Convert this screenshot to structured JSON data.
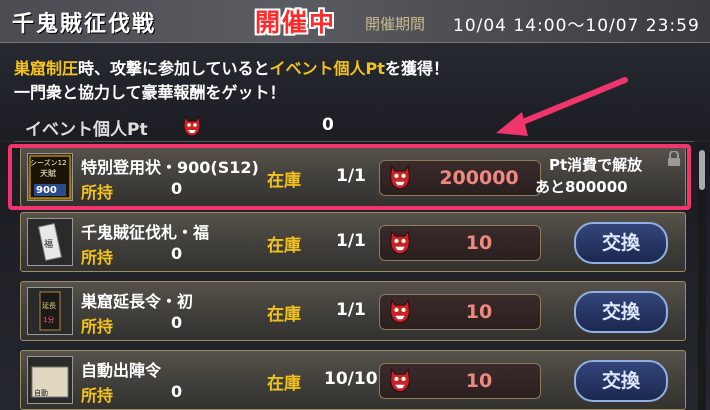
{
  "header": {
    "title": "千鬼賊征伐戦",
    "status_badge": "開催中",
    "period_label": "開催期間",
    "period_value": "10/04 14:00〜10/07 23:59"
  },
  "description": {
    "line1_hl1": "巣窟制圧",
    "line1_mid": "時、攻撃に参加していると",
    "line1_hl2": "イベント個人Pt",
    "line1_end": "を獲得！",
    "line2": "一門衆と協力して豪華報酬をゲット！"
  },
  "points": {
    "label": "イベント個人Pt",
    "value": "0"
  },
  "items": [
    {
      "name": "特別登用状・900(S12)",
      "owned_label": "所持",
      "owned": "0",
      "stock_label": "在庫",
      "stock": "1/1",
      "cost": "200000",
      "locked": true,
      "unlock_line1": "Pt消費で解放",
      "unlock_line2": "あと800000",
      "thumb_text_top": "シーズン12",
      "thumb_text_mid": "天賦",
      "thumb_text_bot": "900"
    },
    {
      "name": "千鬼賊征伐札・福",
      "owned_label": "所持",
      "owned": "0",
      "stock_label": "在庫",
      "stock": "1/1",
      "cost": "10",
      "button": "交換",
      "thumb_text": "福"
    },
    {
      "name": "巣窟延長令・初",
      "owned_label": "所持",
      "owned": "0",
      "stock_label": "在庫",
      "stock": "1/1",
      "cost": "10",
      "button": "交換",
      "thumb_text": "延長",
      "thumb_text2": "1分"
    },
    {
      "name": "自動出陣令",
      "owned_label": "所持",
      "owned": "0",
      "stock_label": "在庫",
      "stock": "10/10",
      "cost": "10",
      "button": "交換",
      "thumb_text": "自動"
    }
  ],
  "colors": {
    "accent_gold": "#f3c21c",
    "live_red": "#ff2a2a",
    "highlight_pink": "#f0356d",
    "cost_red": "#f08880"
  }
}
